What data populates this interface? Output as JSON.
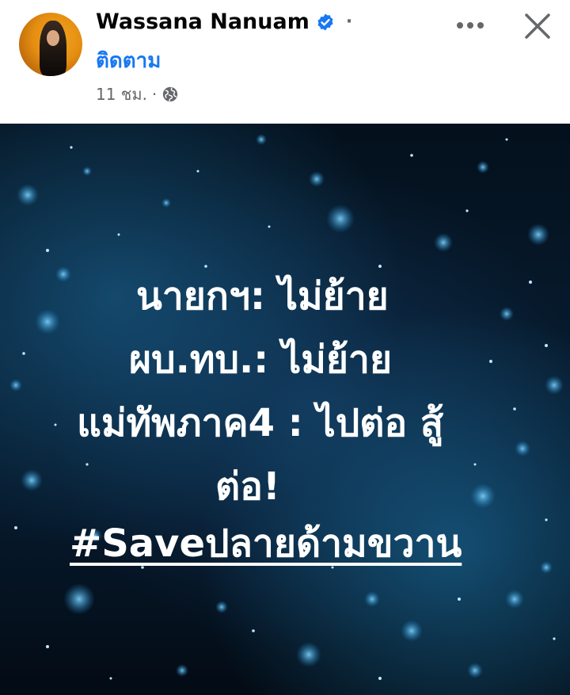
{
  "post": {
    "author": "Wassana Nanuam",
    "follow_label": "ติดตาม",
    "time_label": "11 ชม.",
    "separator": "·",
    "verified_icon": "verified-badge-icon",
    "privacy_icon": "globe-icon",
    "more_icon": "more-options-icon",
    "close_icon": "close-icon"
  },
  "image_text": {
    "line1": "นายกฯ: ไม่ย้าย",
    "line2": "ผบ.ทบ.: ไม่ย้าย",
    "line3": "แม่ทัพภาค4 : ไปต่อ สู้",
    "line4": "ต่อ!",
    "hashtag": "#Saveปลายด้ามขวาน"
  },
  "colors": {
    "brand_blue": "#1877f2",
    "text_primary": "#050505",
    "text_secondary": "#65676b",
    "image_bg": "#071b2e"
  }
}
